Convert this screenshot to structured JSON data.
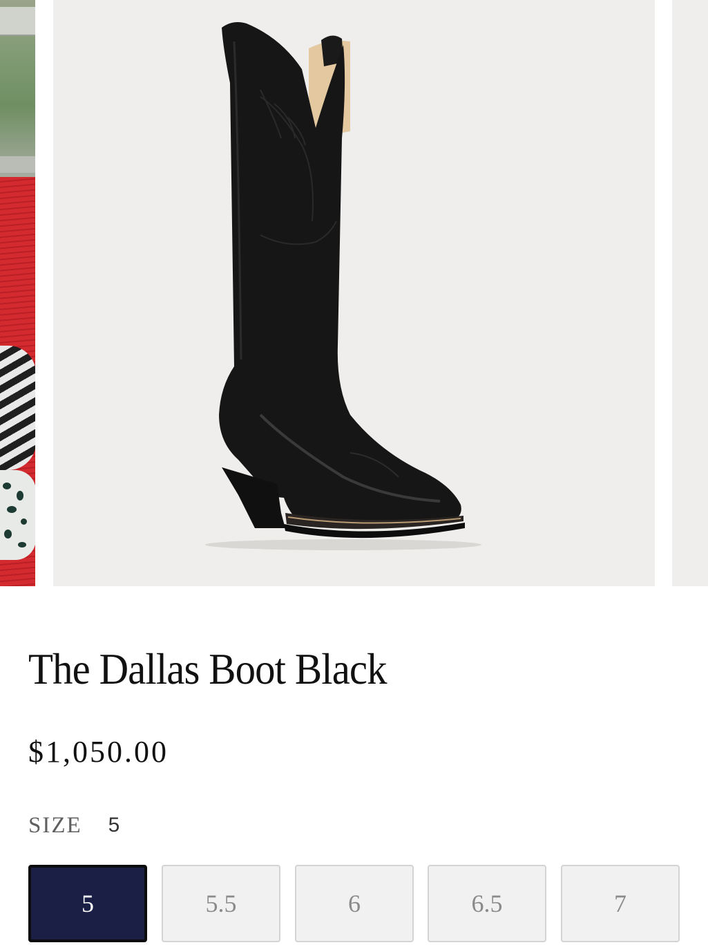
{
  "gallery": {
    "main_image_alt": "The Dallas Boot Black",
    "colors": {
      "image_background": "#efeeec",
      "boot": "#141414"
    }
  },
  "product": {
    "title": "The Dallas Boot Black",
    "price": "$1,050.00"
  },
  "size_selector": {
    "label": "SIZE",
    "selected_value": "5",
    "options": [
      {
        "label": "5",
        "selected": true
      },
      {
        "label": "5.5",
        "selected": false
      },
      {
        "label": "6",
        "selected": false
      },
      {
        "label": "6.5",
        "selected": false
      },
      {
        "label": "7",
        "selected": false
      }
    ],
    "colors": {
      "selected_background": "#1b1f46",
      "unselected_background": "#f1f1f1"
    }
  }
}
